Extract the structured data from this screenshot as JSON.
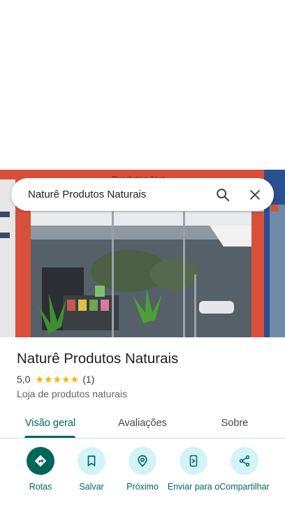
{
  "search": {
    "query": "Naturê Produtos Naturais"
  },
  "place": {
    "name": "Naturê Produtos Naturais",
    "rating": "5,0",
    "stars": "★★★★★",
    "review_count": "(1)",
    "category": "Loja de produtos naturais"
  },
  "photo": {
    "sign_text": "Produtos Nat"
  },
  "tabs": [
    {
      "label": "Visão geral",
      "selected": true
    },
    {
      "label": "Avaliações",
      "selected": false
    },
    {
      "label": "Sobre",
      "selected": false
    }
  ],
  "actions": [
    {
      "label": "Rotas",
      "icon": "directions-icon"
    },
    {
      "label": "Salvar",
      "icon": "bookmark-icon"
    },
    {
      "label": "Próximo",
      "icon": "nearby-icon"
    },
    {
      "label": "Enviar para o",
      "icon": "send-to-phone-icon"
    },
    {
      "label": "Compartilhar",
      "icon": "share-icon"
    }
  ],
  "colors": {
    "accent": "#00665b",
    "chip_bg": "#d2f3f8",
    "star": "#f4b400"
  }
}
